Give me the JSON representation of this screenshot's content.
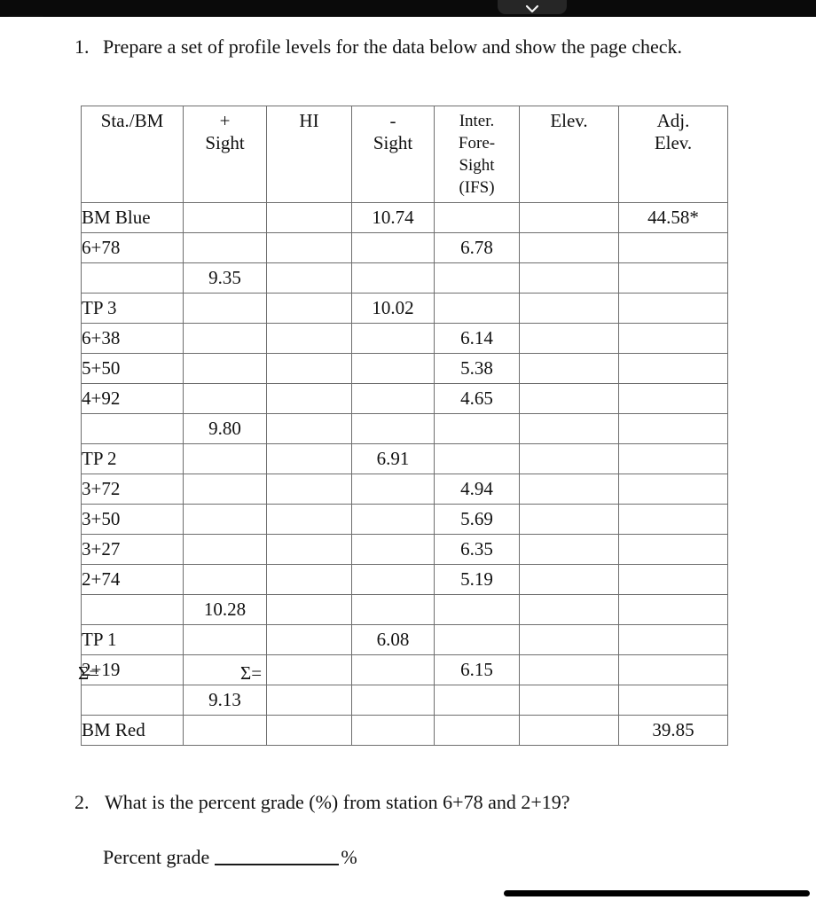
{
  "window": {
    "status_bar_color": "#0a0a0a",
    "notch_icon": "chevron-down-icon"
  },
  "nav": {
    "back_icon": "chevron-left-icon",
    "back_label": ""
  },
  "question1": {
    "number": "1.",
    "text": "Prepare a set of profile levels for the data below and show the page check."
  },
  "table": {
    "headers": [
      "Sta./BM",
      "+\nSight",
      "HI",
      "-\nSight",
      "Inter. Fore-Sight (IFS)",
      "Elev.",
      "Adj. Elev."
    ],
    "headers_parts": {
      "sta_bm": "Sta./BM",
      "plus_sign": "+",
      "plus_sight": "Sight",
      "hi": "HI",
      "minus_sign": "-",
      "minus_sight": "Sight",
      "ifs_l1": "Inter.",
      "ifs_l2": "Fore-",
      "ifs_l3": "Sight",
      "ifs_l4": "(IFS)",
      "elev": "Elev.",
      "adj_l1": "Adj.",
      "adj_l2": "Elev."
    },
    "rows": [
      {
        "sta": "BM Blue",
        "plus": "",
        "hi": "",
        "minus": "10.74",
        "ifs": "",
        "elev": "",
        "adj": "44.58*"
      },
      {
        "sta": "6+78",
        "plus": "",
        "hi": "",
        "minus": "",
        "ifs": "6.78",
        "elev": "",
        "adj": ""
      },
      {
        "sta": "",
        "plus": "9.35",
        "hi": "",
        "minus": "",
        "ifs": "",
        "elev": "",
        "adj": ""
      },
      {
        "sta": "TP 3",
        "plus": "",
        "hi": "",
        "minus": "10.02",
        "ifs": "",
        "elev": "",
        "adj": ""
      },
      {
        "sta": "6+38",
        "plus": "",
        "hi": "",
        "minus": "",
        "ifs": "6.14",
        "elev": "",
        "adj": ""
      },
      {
        "sta": "5+50",
        "plus": "",
        "hi": "",
        "minus": "",
        "ifs": "5.38",
        "elev": "",
        "adj": ""
      },
      {
        "sta": "4+92",
        "plus": "",
        "hi": "",
        "minus": "",
        "ifs": "4.65",
        "elev": "",
        "adj": ""
      },
      {
        "sta": "",
        "plus": "9.80",
        "hi": "",
        "minus": "",
        "ifs": "",
        "elev": "",
        "adj": ""
      },
      {
        "sta": "TP 2",
        "plus": "",
        "hi": "",
        "minus": "6.91",
        "ifs": "",
        "elev": "",
        "adj": ""
      },
      {
        "sta": "3+72",
        "plus": "",
        "hi": "",
        "minus": "",
        "ifs": "4.94",
        "elev": "",
        "adj": ""
      },
      {
        "sta": "3+50",
        "plus": "",
        "hi": "",
        "minus": "",
        "ifs": "5.69",
        "elev": "",
        "adj": ""
      },
      {
        "sta": "3+27",
        "plus": "",
        "hi": "",
        "minus": "",
        "ifs": "6.35",
        "elev": "",
        "adj": ""
      },
      {
        "sta": "2+74",
        "plus": "",
        "hi": "",
        "minus": "",
        "ifs": "5.19",
        "elev": "",
        "adj": ""
      },
      {
        "sta": "",
        "plus": "10.28",
        "hi": "",
        "minus": "",
        "ifs": "",
        "elev": "",
        "adj": ""
      },
      {
        "sta": "TP 1",
        "plus": "",
        "hi": "",
        "minus": "6.08",
        "ifs": "",
        "elev": "",
        "adj": ""
      },
      {
        "sta": "2+19",
        "plus": "",
        "hi": "",
        "minus": "",
        "ifs": "6.15",
        "elev": "",
        "adj": ""
      },
      {
        "sta": "",
        "plus": "9.13",
        "hi": "",
        "minus": "",
        "ifs": "",
        "elev": "",
        "adj": ""
      },
      {
        "sta": "BM Red",
        "plus": "",
        "hi": "",
        "minus": "",
        "ifs": "",
        "elev": "",
        "adj": "39.85"
      }
    ],
    "sum_plus_label": "Σ=",
    "sum_minus_label": "Σ="
  },
  "question2": {
    "number": "2.",
    "text": "What is the percent grade (%) from station 6+78 and 2+19?",
    "answer_label": "Percent grade",
    "answer_value": "",
    "answer_unit": "%"
  }
}
